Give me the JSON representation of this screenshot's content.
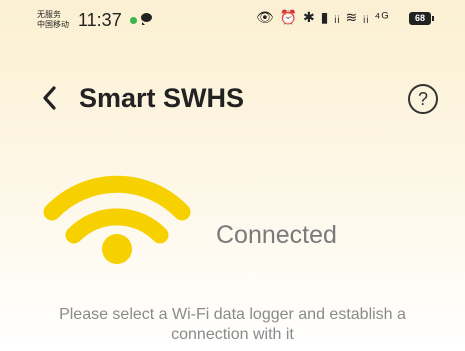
{
  "status_bar": {
    "carrier_line1": "无服务",
    "carrier_line2": "中国移动",
    "time": "11:37",
    "right_icons": "👁 ⏰ ✱ ▮ ᵢᵢ ≋ ᵢᵢ ⁴ᴳ",
    "battery": "68"
  },
  "header": {
    "title": "Smart SWHS",
    "help_symbol": "?"
  },
  "connection": {
    "status": "Connected",
    "accent_color": "#f7d000"
  },
  "hint": "Please select a Wi-Fi data logger and establish a connection with it"
}
